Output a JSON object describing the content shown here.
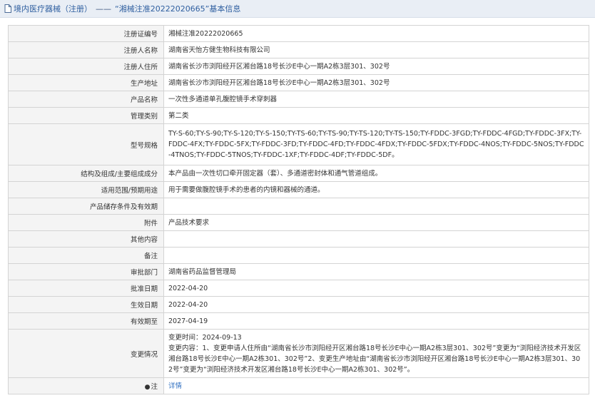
{
  "header": {
    "category": "境内医疗器械（注册）",
    "separator": "——",
    "title": "“湘械注准20222020665”基本信息"
  },
  "rows": [
    {
      "label": "注册证编号",
      "value": "湘械注准20222020665"
    },
    {
      "label": "注册人名称",
      "value": "湖南省天怡方健生物科技有限公司"
    },
    {
      "label": "注册人住所",
      "value": "湖南省长沙市浏阳经开区湘台路18号长沙E中心一期A2栋3层301、302号"
    },
    {
      "label": "生产地址",
      "value": "湖南省长沙市浏阳经开区湘台路18号长沙E中心一期A2栋3层301、302号"
    },
    {
      "label": "产品名称",
      "value": "一次性多通道单孔腹腔镜手术穿刺器"
    },
    {
      "label": "管理类别",
      "value": "第二类"
    },
    {
      "label": "型号规格",
      "value": "TY-S-60;TY-S-90;TY-S-120;TY-S-150;TY-TS-60;TY-TS-90;TY-TS-120;TY-TS-150;TY-FDDC-3FGD;TY-FDDC-4FGD;TY-FDDC-3FX;TY-FDDC-4FX;TY-FDDC-5FX;TY-FDDC-3FD;TY-FDDC-4FD;TY-FDDC-4FDX;TY-FDDC-5FDX;TY-FDDC-4NOS;TY-FDDC-5NOS;TY-FDDC-4TNOS;TY-FDDC-5TNOS;TY-FDDC-1XF;TY-FDDC-4DF;TY-FDDC-5DF。"
    },
    {
      "label": "结构及组成/主要组成成分",
      "value": "本产品由一次性切口牵开固定器（套）、多通道密封体和通气管道组成。"
    },
    {
      "label": "适用范围/预期用途",
      "value": "用于需要做腹腔镜手术的患者的内镜和器械的通道。"
    },
    {
      "label": "产品储存条件及有效期",
      "value": ""
    },
    {
      "label": "附件",
      "value": "产品技术要求"
    },
    {
      "label": "其他内容",
      "value": ""
    },
    {
      "label": "备注",
      "value": ""
    },
    {
      "label": "审批部门",
      "value": "湖南省药品监督管理局"
    },
    {
      "label": "批准日期",
      "value": "2022-04-20"
    },
    {
      "label": "生效日期",
      "value": "2022-04-20"
    },
    {
      "label": "有效期至",
      "value": "2027-04-19"
    }
  ],
  "change": {
    "label": "变更情况",
    "time_line": "变更时间：2024-09-13",
    "content": "变更内容：1、变更申请人住所由“湖南省长沙市浏阳经开区湘台路18号长沙E中心一期A2栋3层301、302号”变更为“浏阳经济技术开发区湘台路18号长沙E中心一期A2栋301、302号”2、变更生产地址由“湖南省长沙市浏阳经开区湘台路18号长沙E中心一期A2栋3层301、302号”变更为“浏阳经济技术开发区湘台路18号长沙E中心一期A2栋301、302号”。"
  },
  "note_row": {
    "label": "注",
    "icon": "pin-icon",
    "link": "详情"
  }
}
